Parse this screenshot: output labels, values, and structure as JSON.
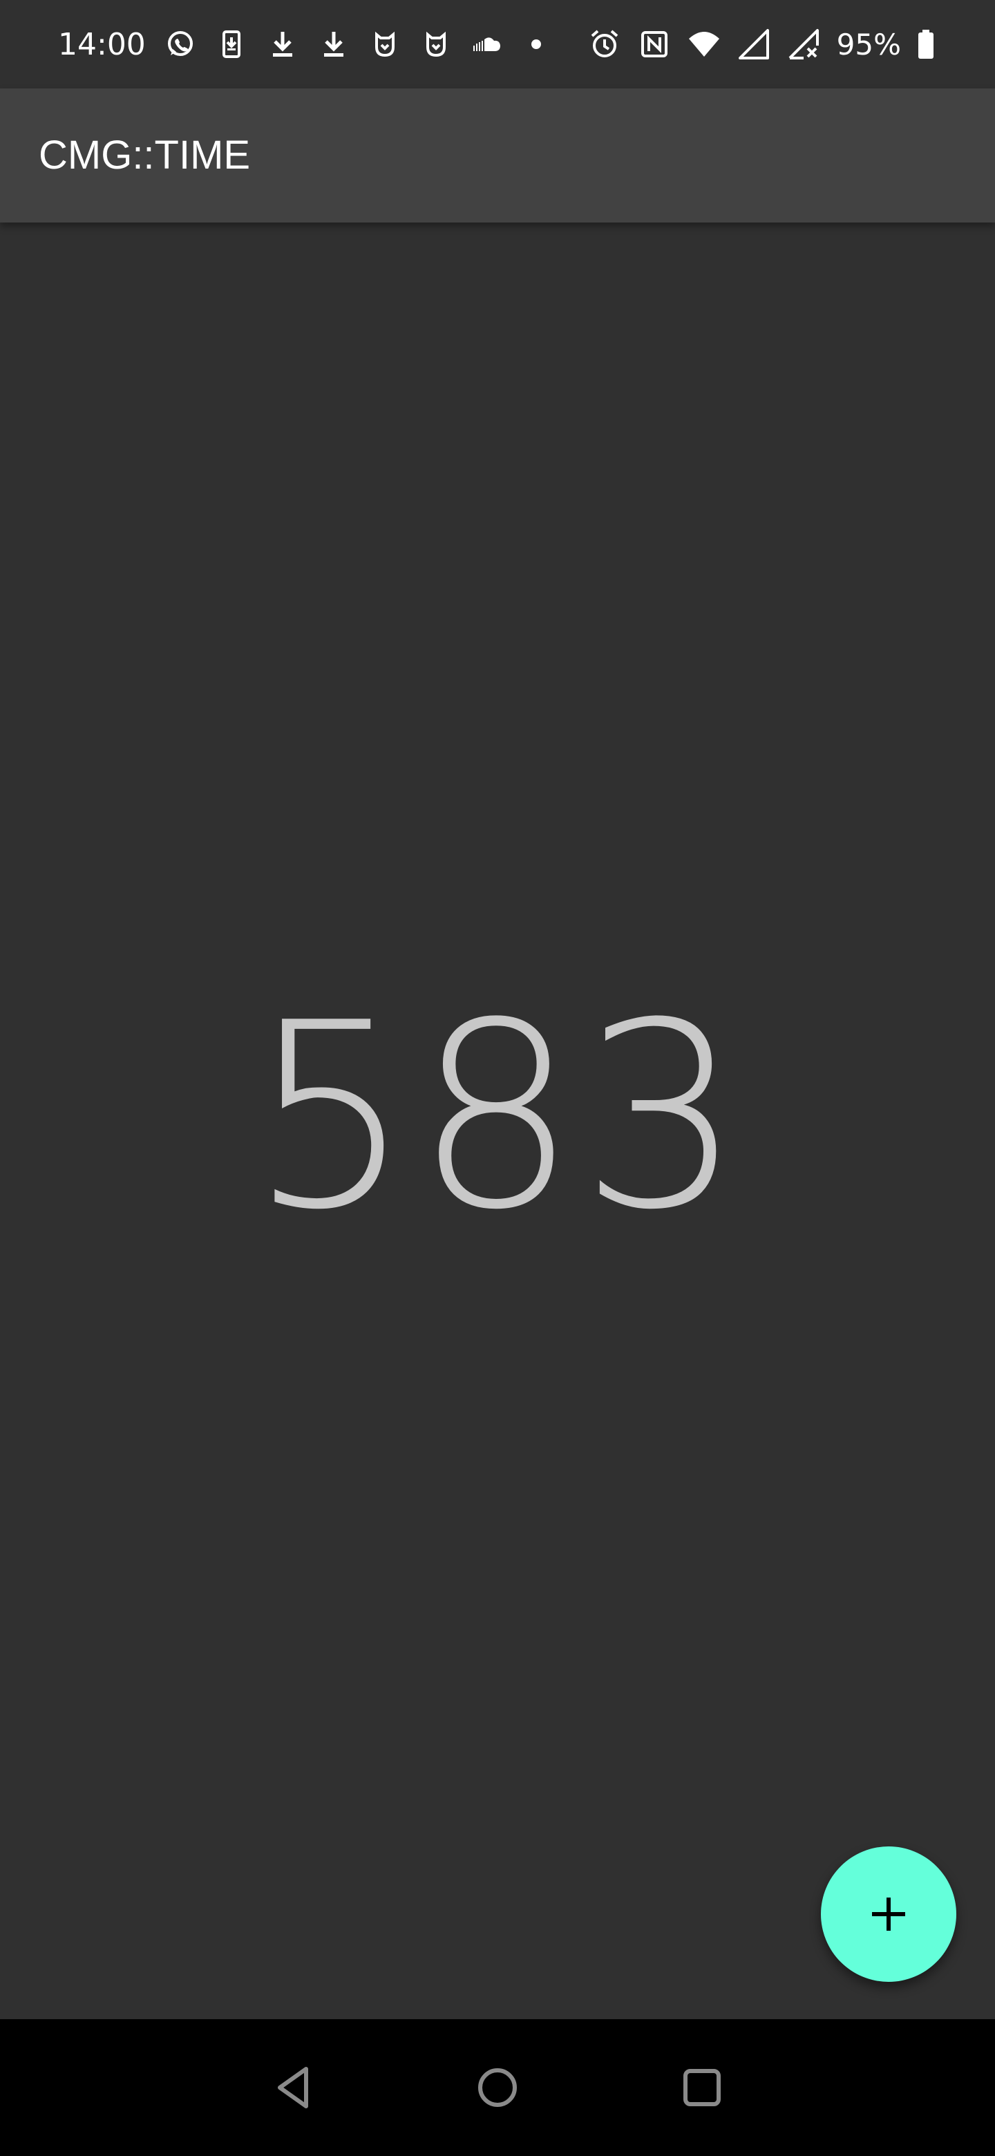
{
  "status_bar": {
    "time": "14:00",
    "battery_percent": "95%",
    "left_icons": [
      "whatsapp-icon",
      "app-update-icon",
      "download-icon",
      "download-icon",
      "mi-home-icon",
      "mi-home-icon",
      "soundcloud-icon",
      "more-notifications-dot"
    ],
    "right_icons": [
      "alarm-icon",
      "nfc-icon",
      "wifi-icon",
      "signal-icon",
      "signal-no-sim-icon",
      "battery-icon"
    ]
  },
  "toolbar": {
    "title": "CMG::TIME"
  },
  "main": {
    "counter": "583"
  },
  "fab": {
    "icon": "plus-icon"
  },
  "navigation_bar": {
    "buttons": [
      "back-icon",
      "home-icon",
      "recents-icon"
    ]
  },
  "colors": {
    "background": "#303030",
    "toolbar": "#424242",
    "counter_text": "#c8c8c8",
    "fab": "#64ffda",
    "nav_bar": "#000000"
  }
}
